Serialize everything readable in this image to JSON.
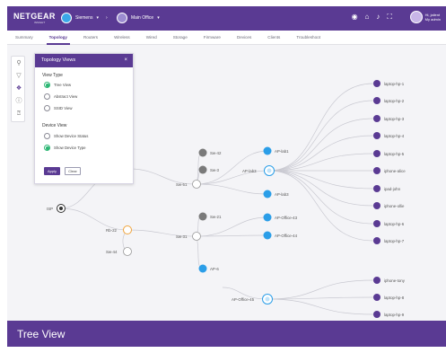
{
  "header": {
    "logo": "NETGEAR",
    "logo_sub": "INSIGHT",
    "org": "Siemens",
    "location": "Main Office",
    "user_greeting": "Hi, jailent",
    "user_role": "My admin"
  },
  "tabs": [
    "Summary",
    "Topology",
    "Routers",
    "Wireless",
    "Wired",
    "Storage",
    "Firmware",
    "Devices",
    "Clients",
    "Troubleshoot"
  ],
  "active_tab": "Topology",
  "panel": {
    "title": "Topology Views",
    "close": "×",
    "view_type_title": "View Type",
    "view_types": [
      "Tree View",
      "Abstract View",
      "SSID View"
    ],
    "selected_view_type": "Tree View",
    "device_view_title": "Device View",
    "device_views": [
      "Show Device Status",
      "Show Device Type"
    ],
    "selected_device_view": "Show Device Type",
    "apply": "Apply",
    "clear": "Clear"
  },
  "tree": {
    "nodes": {
      "isp": "ISP",
      "rb22": "Rb-22",
      "sw44": "Sw-44",
      "sw51": "Sw-51",
      "sw31": "Sw-31",
      "sw42": "Sw-42",
      "sw3": "Sw-3",
      "sw21": "Sw-21",
      "aplab1": "AP-lab1",
      "aplab3": "AP-lab3",
      "aplab3b": "AP-lab3",
      "apoffice43": "AP-Office-43",
      "apoffice44": "AP-Office-44",
      "ap6": "AP-6",
      "apoffice45": "AP-Office-45"
    },
    "clients_top": [
      "laptop-hp-1",
      "laptop-hp-2",
      "laptop-hp-3",
      "laptop-hp-4",
      "laptop-hp-5",
      "iphone-alice",
      "ipad-john",
      "iphone-ollie",
      "laptop-hp-6",
      "laptop-hp-7"
    ],
    "clients_bottom": [
      "iphone-tony",
      "laptop-hp-8",
      "laptop-hp-9"
    ]
  },
  "colors": {
    "brand": "#5a3a93",
    "switch": "#7a7a7a",
    "ap": "#2b9ee8",
    "client": "#5a3a93",
    "router": "#f0a43c",
    "selected": "#2bb673"
  },
  "caption": "Tree View"
}
